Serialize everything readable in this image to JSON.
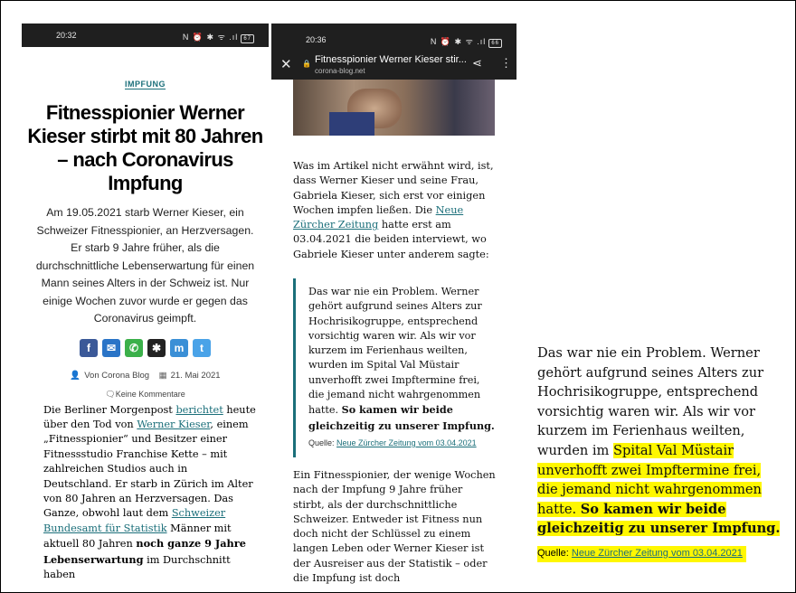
{
  "panel1": {
    "status": {
      "time": "20:32",
      "icons": "N ⏰ ✱ ᯤ .ıl",
      "battery": "67"
    },
    "category": "IMPFUNG",
    "headline": "Fitnesspionier Werner Kieser stirbt mit 80 Jahren – nach Coronavirus Impfung",
    "lead": "Am 19.05.2021 starb Werner Kieser, ein Schweizer Fitnesspionier, an Herzversagen. Er starb 9 Jahre früher, als die durchschnittliche Lebenserwartung für einen Mann seines Alters in der Schweiz ist. Nur einige Wochen zuvor wurde er gegen das Coronavirus geimpft.",
    "share_buttons": [
      {
        "icon": "facebook-icon",
        "glyph": "f",
        "color": "#3b5998"
      },
      {
        "icon": "email-icon",
        "glyph": "✉",
        "color": "#2a74c7"
      },
      {
        "icon": "whatsapp-icon",
        "glyph": "✆",
        "color": "#3bb04a"
      },
      {
        "icon": "star-icon",
        "glyph": "✱",
        "color": "#222222"
      },
      {
        "icon": "mastodon-icon",
        "glyph": "m",
        "color": "#3a8fd6"
      },
      {
        "icon": "twitter-icon",
        "glyph": "t",
        "color": "#4aa3e8"
      }
    ],
    "author": "Von Corona Blog",
    "date": "21. Mai 2021",
    "comments": "Keine Kommentare",
    "p1": {
      "a": "Die Berliner Morgenpost ",
      "link1": "berichtet",
      "b": " heute über den Tod von ",
      "link2": "Werner Kieser",
      "c": ", einem „Fitnesspionier“ und Besitzer einer Fitnessstudio Franchise Kette – mit zahlreichen Studios auch in Deutschland. Er starb in Zürich im Alter von 80 Jahren an Herzversagen. Das Ganze, obwohl laut dem ",
      "link3": "Schweizer Bundesamt für Statistik",
      "d": " Männer mit aktuell 80 Jahren ",
      "bold": "noch ganze 9 Jahre Lebenserwartung",
      "e": " im Durchschnitt haben"
    }
  },
  "panel2": {
    "status": {
      "time": "20:36",
      "icons": "N ⏰ ✱ ᯤ .ıl",
      "battery": "66"
    },
    "tab_title": "Fitnesspionier Werner Kieser stir...",
    "url": "corona-blog.net",
    "para1": {
      "a": "Was im Artikel nicht erwähnt wird, ist, dass Werner Kieser und seine Frau, Gabriela Kieser, sich erst vor einigen Wochen impfen ließen. Die ",
      "link": "Neue Zürcher Zeitung",
      "b": " hatte erst am 03.04.2021 die beiden interviewt, wo Gabriele Kieser unter anderem sagte:"
    },
    "quote": {
      "text": "Das war nie ein Problem. Werner gehört aufgrund seines Alters zur Hochrisikogruppe, entsprechend vorsichtig waren wir. Als wir vor kurzem im Ferienhaus weilten, wurden im Spital Val Müstair unverhofft zwei Impftermine frei, die jemand nicht wahrgenommen hatte. ",
      "bold": "So kamen wir beide gleichzeitig zu unserer Impfung.",
      "source_label": "Quelle: ",
      "source_link": "Neue Zürcher Zeitung vom 03.04.2021"
    },
    "para2": "Ein Fitnesspionier, der wenige Wochen nach der Impfung 9 Jahre früher stirbt, als der durchschnittliche Schweizer. Entweder ist Fitness nun doch nicht der Schlüssel zu einem langen Leben oder Werner Kieser ist der Ausreiser aus der Statistik – oder die Impfung ist doch"
  },
  "panel3": {
    "plain": "Das war nie ein Problem. Werner gehört aufgrund seines Alters zur Hochrisikogruppe, entsprechend vorsichtig waren wir. Als wir vor kurzem im Ferienhaus weilten, wurden im ",
    "highlighted": "Spital Val Müstair unverhofft zwei Impftermine frei, die jemand nicht wahrgenommen hatte. ",
    "highlighted_bold": "So kamen wir beide gleichzeitig zu unserer Impfung.",
    "source_label": "Quelle: ",
    "source_link": "Neue Zürcher Zeitung vom 03.04.2021",
    "highlight_color": "#fff700"
  }
}
